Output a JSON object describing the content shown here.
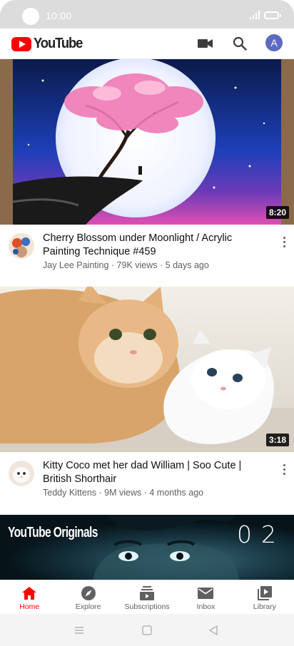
{
  "status_bar": {
    "time": "10:00"
  },
  "app_bar": {
    "logo_text": "YouTube",
    "account_initial": "A",
    "icons": [
      "video-camera-icon",
      "search-icon"
    ]
  },
  "colors": {
    "brand_red": "#ff0000",
    "avatar": "#5c6bc0",
    "secondary_text": "#606060"
  },
  "videos": [
    {
      "title": "Cherry Blossom under Moonlight / Acrylic Painting Technique #459",
      "channel": "Jay Lee Painting",
      "views": "79K views",
      "age": "5 days ago",
      "duration": "8:20"
    },
    {
      "title": "Kitty Coco met  her dad William | Soo Cute | British Shorthair",
      "channel": "Teddy Kittens",
      "views": "9M views",
      "age": "4 months ago",
      "duration": "3:18"
    },
    {
      "originals_label": "YouTube Originals",
      "episode": "02"
    }
  ],
  "meta_separator": " · ",
  "bottom_nav": [
    {
      "label": "Home",
      "icon": "home-icon",
      "active": true
    },
    {
      "label": "Explore",
      "icon": "compass-icon",
      "active": false
    },
    {
      "label": "Subscriptions",
      "icon": "subscriptions-icon",
      "active": false
    },
    {
      "label": "Inbox",
      "icon": "mail-icon",
      "active": false
    },
    {
      "label": "Library",
      "icon": "library-icon",
      "active": false
    }
  ]
}
